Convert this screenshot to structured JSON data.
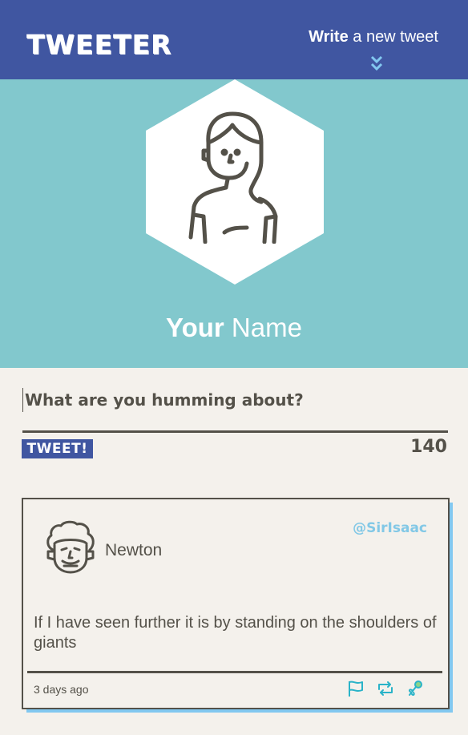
{
  "header": {
    "logo": "TWEETER",
    "write_bold": "Write",
    "write_rest": " a new tweet",
    "chevron_icon": "double-chevron-down-icon"
  },
  "profile": {
    "name_bold": "Your",
    "name_rest": " Name",
    "avatar_icon": "woman-avatar-icon"
  },
  "composer": {
    "placeholder": "What are you humming about?",
    "button_label": "TWEET!",
    "char_count": "140"
  },
  "tweet": {
    "name": "Newton",
    "handle": "@SirIsaac",
    "text": "If I have seen further it is by standing on the shoulders of giants",
    "time": "3 days ago",
    "avatar_icon": "newton-avatar-icon",
    "actions": [
      "flag-icon",
      "retweet-icon",
      "like-icon"
    ]
  },
  "colors": {
    "header": "#4056a1",
    "profile_bg": "#82c8cd",
    "page_bg": "#f4f1ec",
    "text": "#545149",
    "accent_shadow": "#82c8f0",
    "action_icons": "#2ab3c8"
  }
}
